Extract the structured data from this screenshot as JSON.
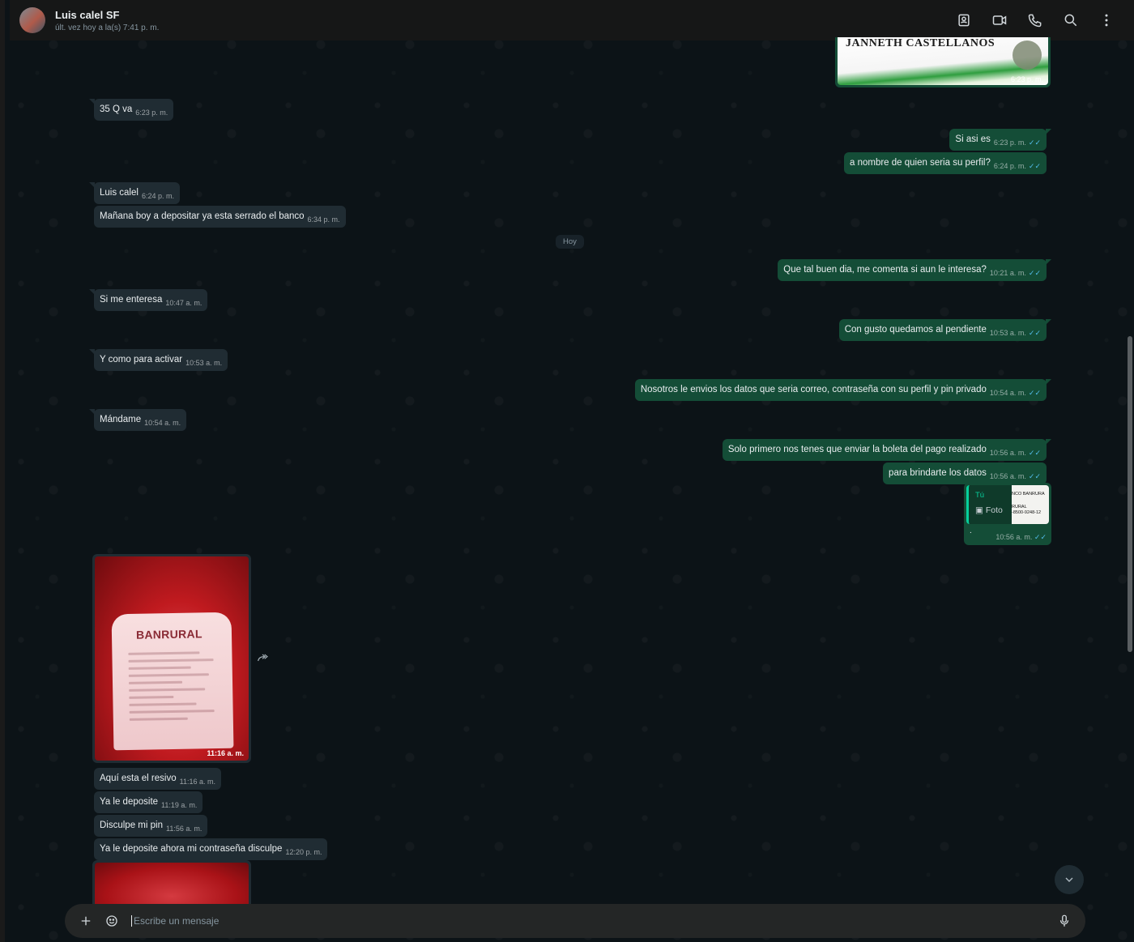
{
  "header": {
    "contact_name": "Luis calel SF",
    "status": "últ. vez hoy a la(s) 7:41 p. m."
  },
  "day_separator": "Hoy",
  "top_image": {
    "caption_text": "JANNETH CASTELLANOS",
    "time": "6:23 p. m."
  },
  "messages": [
    {
      "text": "35 Q va",
      "time": "6:23 p. m.",
      "dir": "in"
    },
    {
      "text": "Si asi es",
      "time": "6:23 p. m.",
      "dir": "out"
    },
    {
      "text": "a nombre de quien seria su perfil?",
      "time": "6:24 p. m.",
      "dir": "out"
    },
    {
      "text": "Luis calel",
      "time": "6:24 p. m.",
      "dir": "in"
    },
    {
      "text": "Mañana boy a depositar ya esta serrado el banco",
      "time": "6:34 p. m.",
      "dir": "in"
    },
    {
      "text": "Que tal buen dia, me comenta si aun le interesa?",
      "time": "10:21 a. m.",
      "dir": "out"
    },
    {
      "text": "Si me enteresa",
      "time": "10:47 a. m.",
      "dir": "in"
    },
    {
      "text": "Con gusto quedamos al pendiente",
      "time": "10:53 a. m.",
      "dir": "out"
    },
    {
      "text": "Y como para activar",
      "time": "10:53 a. m.",
      "dir": "in"
    },
    {
      "text": "Nosotros le envios los datos que seria correo, contraseña con su perfil y pin privado",
      "time": "10:54 a. m.",
      "dir": "out"
    },
    {
      "text": "Mándame",
      "time": "10:54 a. m.",
      "dir": "in"
    },
    {
      "text": "Solo primero nos tenes que enviar la boleta del pago realizado",
      "time": "10:56 a. m.",
      "dir": "out"
    },
    {
      "text": "para brindarte los datos",
      "time": "10:56 a. m.",
      "dir": "out"
    },
    {
      "text": "Aquí esta el resivo",
      "time": "11:16 a. m.",
      "dir": "in"
    },
    {
      "text": "Ya le deposite",
      "time": "11:19 a. m.",
      "dir": "in"
    },
    {
      "text": "Disculpe mi pin",
      "time": "11:56 a. m.",
      "dir": "in"
    },
    {
      "text": "Ya le deposite ahora mi contraseña disculpe",
      "time": "12:20 p. m.",
      "dir": "in"
    }
  ],
  "reply": {
    "from": "Tú",
    "kind": "Foto",
    "thumb_lines": [
      "NCO BANRURA",
      "RURAL",
      "-8500-9248-12"
    ],
    "text": ".",
    "time": "10:56 a. m."
  },
  "receipt_image": {
    "brand": "BANRURAL",
    "time": "11:16 a. m."
  },
  "composer": {
    "placeholder": "Escribe un mensaje"
  },
  "icons": {
    "header": [
      "contact-card-icon",
      "video-call-icon",
      "phone-icon",
      "search-icon",
      "menu-icon"
    ],
    "composer": [
      "plus-icon",
      "sticker-icon",
      "mic-icon"
    ]
  },
  "colors": {
    "incoming_bubble": "#202c33",
    "outgoing_bubble": "#144d37",
    "read_ticks": "#53bdeb",
    "header_bg": "#161717"
  }
}
